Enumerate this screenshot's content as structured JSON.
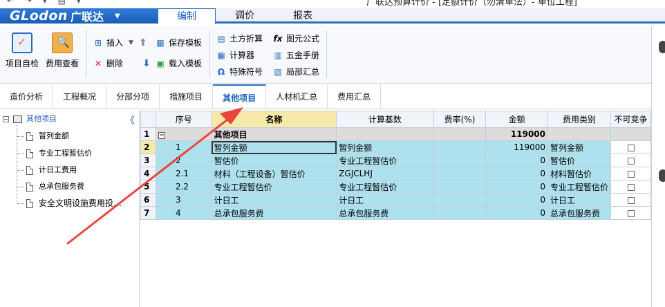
{
  "window": {
    "quick_access": "↶ ↷ ▾ ▤ ▾",
    "title": "广联达预算计价 - [定额计价（勿清单法）- 单位工程]"
  },
  "brand": {
    "logo": "GLodon",
    "name": "广联达",
    "dropdown": "▼"
  },
  "menu": {
    "items": [
      {
        "label": "编制",
        "active": true
      },
      {
        "label": "调价",
        "active": false
      },
      {
        "label": "报表",
        "active": false
      }
    ]
  },
  "ribbon": {
    "project_check": "项目自检",
    "fee_view": "费用查看",
    "insert": "插入",
    "delete": "删除",
    "save_template": "保存模板",
    "load_template": "载入模板",
    "earthwork": "土方折算",
    "calculator": "计算器",
    "special_symbol": "特殊符号",
    "formula": "图元公式",
    "hardware_manual": "五金手册",
    "local_summary": "局部汇总"
  },
  "tabs": [
    {
      "label": "造价分析",
      "active": false
    },
    {
      "label": "工程概况",
      "active": false
    },
    {
      "label": "分部分项",
      "active": false
    },
    {
      "label": "措施项目",
      "active": false
    },
    {
      "label": "其他项目",
      "active": true
    },
    {
      "label": "人材机汇总",
      "active": false
    },
    {
      "label": "费用汇总",
      "active": false
    }
  ],
  "tree": {
    "root": "其他项目",
    "collapse_glyph": "《",
    "children": [
      "暂列金额",
      "专业工程暂估价",
      "计日工费用",
      "总承包服务费",
      "安全文明设施费用投…"
    ]
  },
  "grid": {
    "columns": [
      "",
      "序号",
      "名称",
      "计算基数",
      "费率(%)",
      "金额",
      "费用类别",
      "不可竞争"
    ],
    "group_row": {
      "row": "1",
      "name": "其他项目",
      "amount": "119000"
    },
    "rows": [
      {
        "row": "2",
        "seq": "1",
        "name": "暂列金额",
        "base": "暂列金额",
        "rate": "",
        "amount": "119000",
        "category": "暂列金额"
      },
      {
        "row": "3",
        "seq": "2",
        "name": "暂估价",
        "base": "专业工程暂估价",
        "rate": "",
        "amount": "0",
        "category": "暂估价"
      },
      {
        "row": "4",
        "seq": "2.1",
        "name": "材料（工程设备）暂估价",
        "base": "ZGJCLHJ",
        "rate": "",
        "amount": "0",
        "category": "材料暂估价"
      },
      {
        "row": "5",
        "seq": "2.2",
        "name": "专业工程暂估价",
        "base": "专业工程暂估价",
        "rate": "",
        "amount": "0",
        "category": "专业工程暂估价"
      },
      {
        "row": "6",
        "seq": "3",
        "name": "计日工",
        "base": "计日工",
        "rate": "",
        "amount": "0",
        "category": "计日工"
      },
      {
        "row": "7",
        "seq": "4",
        "name": "总承包服务费",
        "base": "总承包服务费",
        "rate": "",
        "amount": "0",
        "category": "总承包服务费"
      }
    ]
  },
  "colors": {
    "accent": "#2a6cc0",
    "row_fill": "#aee1ee",
    "header_highlight": "#f7e9a8",
    "annotation_arrow": "#e8453c"
  }
}
